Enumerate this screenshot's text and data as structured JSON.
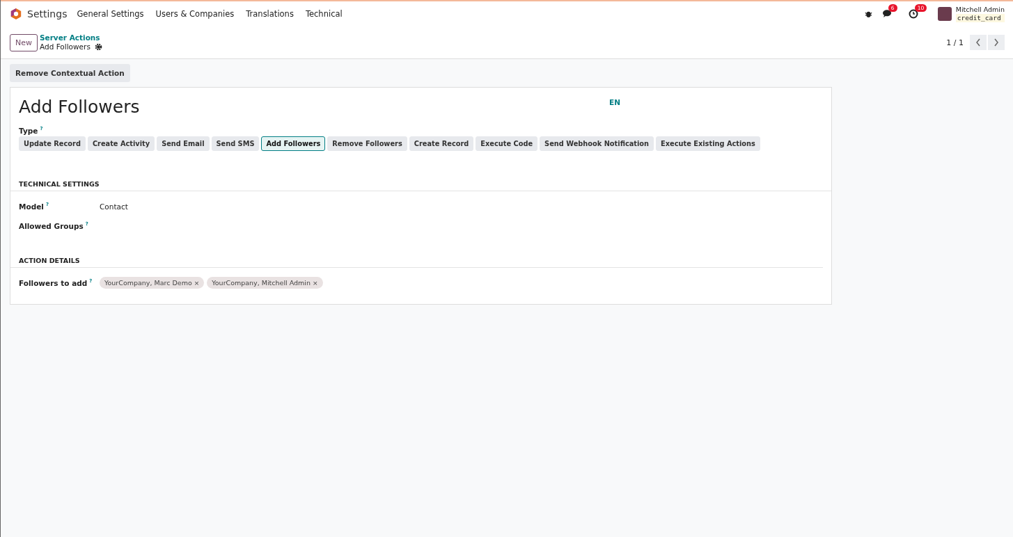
{
  "navbar": {
    "app_name": "Settings",
    "menu": [
      "General Settings",
      "Users & Companies",
      "Translations",
      "Technical"
    ],
    "messages_count": "6",
    "activities_count": "10",
    "user_name": "Mitchell Admin",
    "database": "credit_card"
  },
  "control_panel": {
    "new_button": "New",
    "breadcrumb": "Server Actions",
    "record_title": "Add Followers",
    "pager": "1 / 1"
  },
  "action_button": "Remove Contextual Action",
  "form": {
    "title": "Add Followers",
    "language": "EN",
    "type_label": "Type",
    "help_mark": "?",
    "types": [
      {
        "label": "Update Record",
        "selected": false
      },
      {
        "label": "Create Activity",
        "selected": false
      },
      {
        "label": "Send Email",
        "selected": false
      },
      {
        "label": "Send SMS",
        "selected": false
      },
      {
        "label": "Add Followers",
        "selected": true
      },
      {
        "label": "Remove Followers",
        "selected": false
      },
      {
        "label": "Create Record",
        "selected": false
      },
      {
        "label": "Execute Code",
        "selected": false
      },
      {
        "label": "Send Webhook Notification",
        "selected": false
      },
      {
        "label": "Execute Existing Actions",
        "selected": false
      }
    ],
    "sections": [
      {
        "title": "TECHNICAL SETTINGS",
        "fields": [
          {
            "label": "Model",
            "value": "Contact"
          },
          {
            "label": "Allowed Groups"
          }
        ]
      },
      {
        "title": "ACTION DETAILS",
        "fields": [
          {
            "label": "Followers to add",
            "tags": [
              "YourCompany, Marc Demo",
              "YourCompany, Mitchell Admin"
            ]
          }
        ]
      }
    ],
    "tag_remove": "×"
  }
}
